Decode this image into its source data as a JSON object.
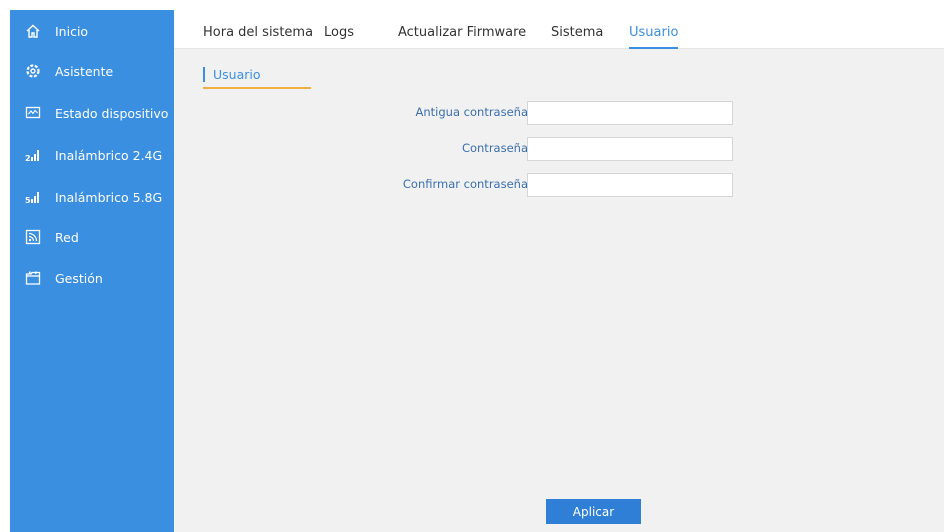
{
  "sidebar": {
    "items": [
      {
        "label": "Inicio",
        "icon": "home-icon"
      },
      {
        "label": "Asistente",
        "icon": "gear-icon"
      },
      {
        "label": "Estado dispositivo",
        "icon": "monitor-icon"
      },
      {
        "label": "Inalámbrico 2.4G",
        "icon": "signal-24g-icon"
      },
      {
        "label": "Inalámbrico 5.8G",
        "icon": "signal-58g-icon"
      },
      {
        "label": "Red",
        "icon": "network-icon"
      },
      {
        "label": "Gestión",
        "icon": "folder-icon"
      }
    ]
  },
  "tabs": [
    {
      "label": "Hora del sistema"
    },
    {
      "label": "Logs"
    },
    {
      "label": "Actualizar Firmware"
    },
    {
      "label": "Sistema"
    },
    {
      "label": "Usuario",
      "active": true
    }
  ],
  "section": {
    "title": "Usuario"
  },
  "form": {
    "old_password_label": "Antigua contraseña",
    "old_password_value": "",
    "password_label": "Contraseña",
    "password_value": "",
    "confirm_password_label": "Confirmar contraseña",
    "confirm_password_value": ""
  },
  "apply_button": "Aplicar",
  "colors": {
    "sidebar_bg": "#3a8fe0",
    "accent": "#3a8fe0",
    "content_bg": "#f1f1f1",
    "underline": "#f0b040",
    "button_bg": "#2f7fd6"
  }
}
